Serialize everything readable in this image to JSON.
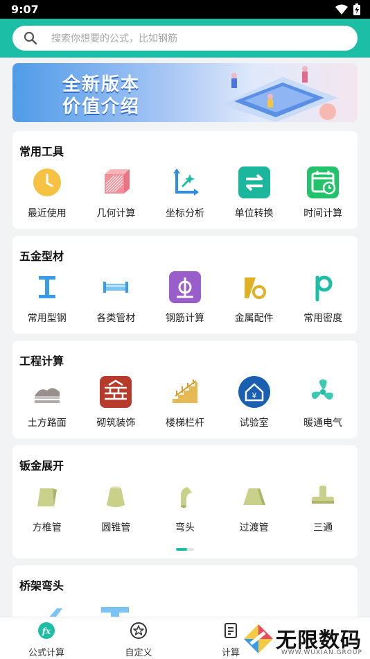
{
  "status_bar": {
    "time": "9:07",
    "icons": [
      "wifi-icon",
      "battery-charging-icon"
    ]
  },
  "search": {
    "placeholder": "搜索你想要的公式，比如钢筋"
  },
  "banner": {
    "line1": "全新版本",
    "line2": "价值介绍"
  },
  "colors": {
    "accent": "#1cbfa6",
    "background": "#f2f3f5"
  },
  "sections": [
    {
      "title": "常用工具",
      "items": [
        {
          "label": "最近使用",
          "icon": "clock-icon"
        },
        {
          "label": "几何计算",
          "icon": "cube-icon"
        },
        {
          "label": "坐标分析",
          "icon": "axis-icon"
        },
        {
          "label": "单位转换",
          "icon": "swap-icon"
        },
        {
          "label": "时间计算",
          "icon": "calendar-clock-icon"
        }
      ]
    },
    {
      "title": "五金型材",
      "items": [
        {
          "label": "常用型钢",
          "icon": "i-beam-icon"
        },
        {
          "label": "各类管材",
          "icon": "pipe-icon"
        },
        {
          "label": "钢筋计算",
          "icon": "rebar-icon"
        },
        {
          "label": "金属配件",
          "icon": "fitting-icon"
        },
        {
          "label": "常用密度",
          "icon": "density-icon"
        }
      ]
    },
    {
      "title": "工程计算",
      "items": [
        {
          "label": "土方路面",
          "icon": "road-icon"
        },
        {
          "label": "砌筑装饰",
          "icon": "brick-icon"
        },
        {
          "label": "楼梯栏杆",
          "icon": "stairs-icon"
        },
        {
          "label": "试验室",
          "icon": "lab-house-icon"
        },
        {
          "label": "暖通电气",
          "icon": "fan-icon"
        }
      ]
    },
    {
      "title": "钣金展开",
      "items": [
        {
          "label": "方椎管",
          "icon": "square-cone-icon"
        },
        {
          "label": "圆锥管",
          "icon": "round-cone-icon"
        },
        {
          "label": "弯头",
          "icon": "elbow-icon"
        },
        {
          "label": "过渡管",
          "icon": "transition-pipe-icon"
        },
        {
          "label": "三通",
          "icon": "tee-icon"
        }
      ]
    },
    {
      "title": "桥架弯头",
      "items": []
    }
  ],
  "tabs": [
    {
      "label": "公式计算",
      "icon": "fx-icon"
    },
    {
      "label": "自定义",
      "icon": "star-circle-icon"
    },
    {
      "label": "计算",
      "icon": "calculator-icon"
    }
  ],
  "watermark": {
    "text": "无限数码",
    "sub": "WWW.WUXIAN.GROUP"
  }
}
